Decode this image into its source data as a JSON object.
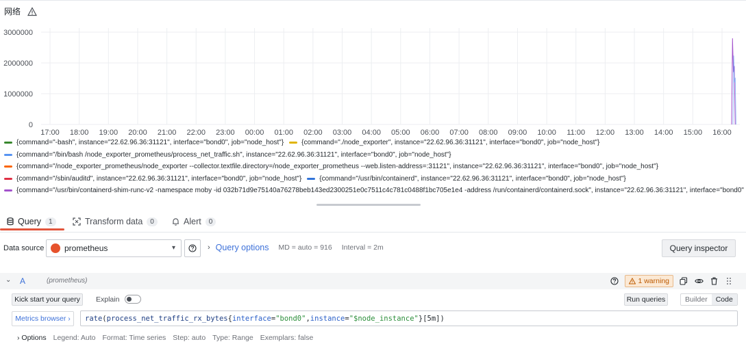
{
  "panel": {
    "title": "网络"
  },
  "chart_data": {
    "type": "line",
    "title": "网络",
    "x_ticks": [
      "17:00",
      "18:00",
      "19:00",
      "20:00",
      "21:00",
      "22:00",
      "23:00",
      "00:00",
      "01:00",
      "02:00",
      "03:00",
      "04:00",
      "05:00",
      "06:00",
      "07:00",
      "08:00",
      "09:00",
      "10:00",
      "11:00",
      "12:00",
      "13:00",
      "14:00",
      "15:00",
      "16:00"
    ],
    "y_ticks": [
      "0",
      "1000000",
      "2000000",
      "3000000"
    ],
    "ylim": [
      0,
      3000000
    ],
    "grid": true,
    "legend_position": "bottom",
    "series": [
      {
        "name": "{command=\"-bash\", instance=\"22.62.96.36:31121\", interface=\"bond0\", job=\"node_host\"}",
        "color": "#37872d"
      },
      {
        "name": "{command=\"./node_exporter\", instance=\"22.62.96.36:31121\", interface=\"bond0\", job=\"node_host\"}",
        "color": "#e0b400"
      },
      {
        "name": "{command=\"/bin/bash /node_exporter_prometheus/process_net_traffic.sh\", instance=\"22.62.96.36:31121\", interface=\"bond0\", job=\"node_host\"}",
        "color": "#5794f2"
      },
      {
        "name": "{command=\"/node_exporter_prometheus/node_exporter --collector.textfile.directory=/node_exporter_prometheus --web.listen-address=:31121\", instance=\"22.62.96.36:31121\", interface=\"bond0\", job=\"node_host\"}",
        "color": "#fa6400"
      },
      {
        "name": "{command=\"/sbin/auditd\", instance=\"22.62.96.36:31121\", interface=\"bond0\", job=\"node_host\"}",
        "color": "#e02f44"
      },
      {
        "name": "{command=\"/usr/bin/containerd\", instance=\"22.62.96.36:31121\", interface=\"bond0\", job=\"node_host\"}",
        "color": "#3274d9"
      },
      {
        "name": "{command=\"/usr/bin/containerd-shim-runc-v2 -namespace moby -id 032b71d9e75140a76278beb143ed2300251e0c7511c4c781c0488f1bc705e1e4 -address /run/containerd/containerd.sock\", instance=\"22.62.96.36:31121\", interface=\"bond0\"",
        "color": "#a352cc"
      }
    ],
    "visible_activity": {
      "series": "containerd-shim",
      "x_range": [
        "16:00",
        "16:30"
      ],
      "values": [
        0,
        2800000,
        1700000,
        1900000,
        0
      ]
    }
  },
  "tabs": [
    {
      "label": "Query",
      "count": "1",
      "icon": "database-icon"
    },
    {
      "label": "Transform data",
      "count": "0",
      "icon": "transform-icon"
    },
    {
      "label": "Alert",
      "count": "0",
      "icon": "bell-icon"
    }
  ],
  "datasource": {
    "label": "Data source",
    "selected": "prometheus"
  },
  "query_options": {
    "title": "Query options",
    "md": "MD = auto = 916",
    "interval": "Interval = 2m"
  },
  "query_inspector_label": "Query inspector",
  "query": {
    "ref_id": "A",
    "ds_name": "(prometheus)",
    "warning": "1 warning",
    "kick_start": "Kick start your query",
    "explain": "Explain",
    "run_queries": "Run queries",
    "mode_builder": "Builder",
    "mode_code": "Code",
    "metrics_browser": "Metrics browser",
    "expr_fn": "rate",
    "expr_metric": "process_net_traffic_rx_bytes",
    "expr_l1": "interface",
    "expr_v1": "\"bond0\"",
    "expr_l2": "instance",
    "expr_v2": "\"$node_instance\"",
    "expr_range": "[5m]"
  },
  "options_row": {
    "label": "Options",
    "legend": "Legend: Auto",
    "format": "Format: Time series",
    "step": "Step: auto",
    "type": "Type: Range",
    "exemplars": "Exemplars: false"
  }
}
